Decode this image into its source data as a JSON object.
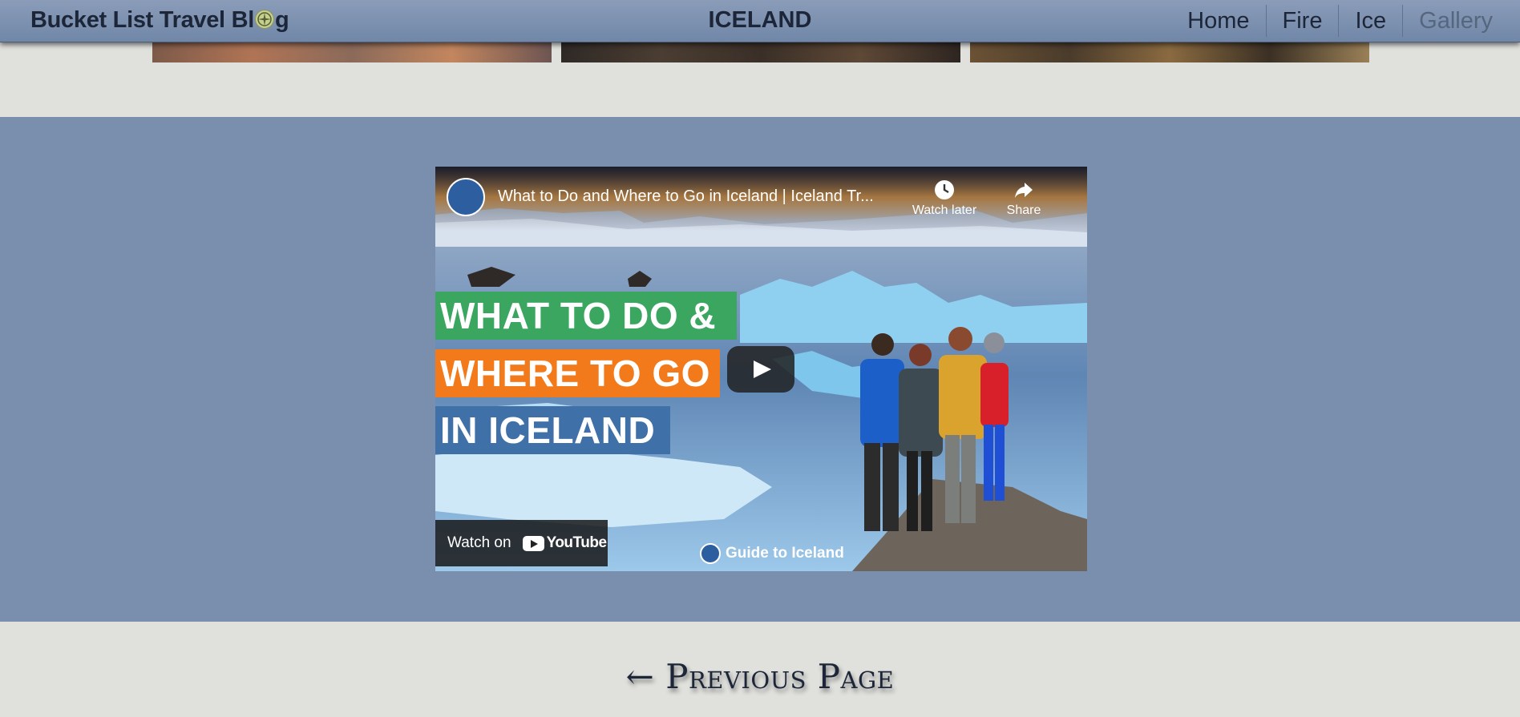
{
  "header": {
    "brand": "Bucket List Travel Bl",
    "brand_suffix": "g",
    "page_title": "ICELAND",
    "nav": [
      {
        "label": "Home"
      },
      {
        "label": "Fire"
      },
      {
        "label": "Ice"
      },
      {
        "label": "Gallery",
        "active": true
      }
    ]
  },
  "video": {
    "title": "What to Do and Where to Go in Iceland | Iceland Tr...",
    "watch_later": "Watch later",
    "share": "Share",
    "banner_lines": [
      "WHAT TO DO &",
      "WHERE TO GO",
      "IN ICELAND"
    ],
    "watch_on": "Watch on",
    "youtube": "YouTube",
    "channel_watermark": "Guide to Iceland"
  },
  "footer": {
    "previous_page": "← Previous Page"
  },
  "colors": {
    "header": "#7187a8",
    "page_bg": "#e0e1dd",
    "band": "#7a8eae",
    "text": "#1c2638",
    "banner_green": "#3aa660",
    "banner_orange": "#f37a1a",
    "banner_blue": "#3f70a8"
  }
}
